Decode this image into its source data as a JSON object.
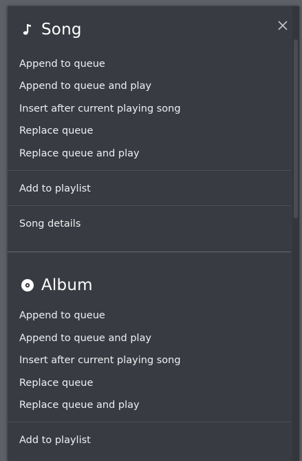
{
  "song": {
    "title": "Song",
    "icon": "music-note-icon",
    "queue_items": [
      "Append to queue",
      "Append to queue and play",
      "Insert after current playing song",
      "Replace queue",
      "Replace queue and play"
    ],
    "add_to_playlist": "Add to playlist",
    "details": "Song details"
  },
  "album": {
    "title": "Album",
    "icon": "album-disc-icon",
    "queue_items": [
      "Append to queue",
      "Append to queue and play",
      "Insert after current playing song",
      "Replace queue",
      "Replace queue and play"
    ],
    "add_to_playlist": "Add to playlist"
  },
  "close_icon": "close-icon",
  "colors": {
    "panel_bg": "#383b41",
    "text": "#eef0f2",
    "divider": "#4d5157"
  }
}
